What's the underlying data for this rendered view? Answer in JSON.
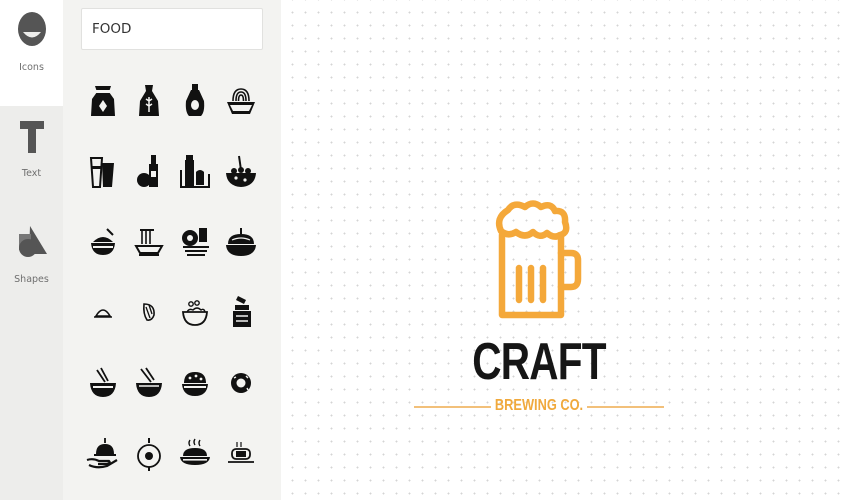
{
  "sidebar": {
    "items": [
      {
        "label": "Icons",
        "icon": "smiley-icon",
        "active": true
      },
      {
        "label": "Text",
        "icon": "text-t-icon",
        "active": false
      },
      {
        "label": "Shapes",
        "icon": "shapes-icon",
        "active": false
      }
    ]
  },
  "icon_panel": {
    "search": {
      "value": "FOOD"
    },
    "icons": [
      "flour-sack-icon",
      "wheat-bag-icon",
      "sauce-bottle-icon",
      "noodle-bowl-icon",
      "drinks-glasses-icon",
      "wine-bottle-icon",
      "milk-and-bread-icon",
      "salad-bowl-icon",
      "rice-bowl-icon",
      "noodles-plate-icon",
      "breakfast-icon",
      "soup-pot-icon",
      "dumpling-icon",
      "sprout-leaf-icon",
      "bowl-outline-icon",
      "jar-icon",
      "chopsticks-bowl-icon",
      "chopsticks-bowl-2-icon",
      "rice-bowl-covered-icon",
      "donut-icon",
      "serving-hand-icon",
      "pan-egg-icon",
      "steaming-dish-icon",
      "sushi-roll-icon"
    ]
  },
  "canvas": {
    "logo": {
      "icon": "beer-mug-icon",
      "title": "CRAFT",
      "subtitle": "BREWING CO.",
      "accent_color": "#f4a83a",
      "subtitle_color": "#f0a93c",
      "title_color": "#161616"
    }
  }
}
